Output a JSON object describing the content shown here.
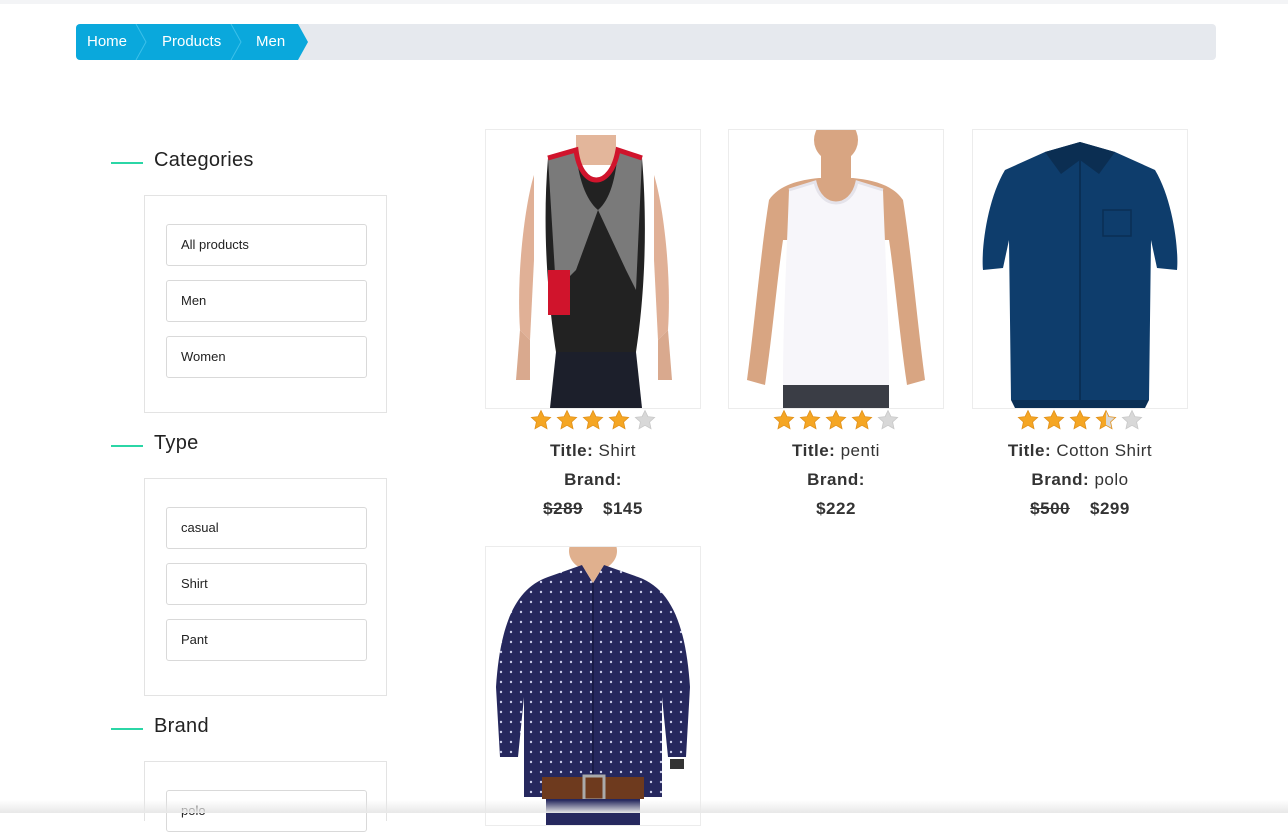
{
  "breadcrumb": {
    "items": [
      {
        "label": "Home"
      },
      {
        "label": "Products"
      },
      {
        "label": "Men"
      }
    ],
    "color": "#0aa8dc"
  },
  "sidebar": {
    "sections": [
      {
        "title": "Categories",
        "items": [
          "All products",
          "Men",
          "Women"
        ]
      },
      {
        "title": "Type",
        "items": [
          "casual",
          "Shirt",
          "Pant"
        ]
      },
      {
        "title": "Brand",
        "items": [
          "polo"
        ]
      }
    ]
  },
  "products": [
    {
      "rating": 4,
      "title_label": "Title:",
      "title": "Shirt",
      "brand_label": "Brand:",
      "brand": "",
      "old_price": "$289",
      "price": "$145",
      "image": "red-black-tank-top"
    },
    {
      "rating": 4,
      "title_label": "Title:",
      "title": "penti",
      "brand_label": "Brand:",
      "brand": "",
      "old_price": "",
      "price": "$222",
      "image": "white-tank-top"
    },
    {
      "rating": 3.5,
      "title_label": "Title:",
      "title": "Cotton Shirt",
      "brand_label": "Brand:",
      "brand": "polo",
      "old_price": "$500",
      "price": "$299",
      "image": "navy-blue-shirt"
    },
    {
      "rating": null,
      "image": "dotted-navy-shirt"
    }
  ],
  "colors": {
    "accent_line": "#2bd6a6",
    "star_filled": "#f5a623",
    "star_empty": "#d8d8d8"
  }
}
